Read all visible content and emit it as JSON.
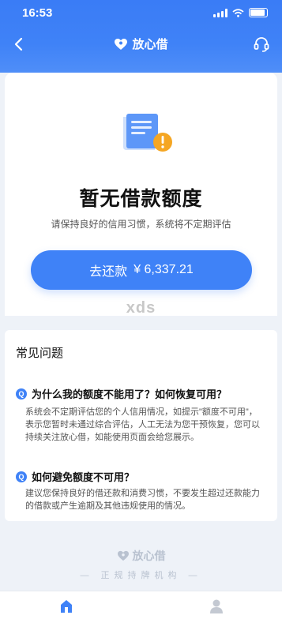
{
  "status_bar": {
    "time": "16:53"
  },
  "nav": {
    "title": "放心借"
  },
  "main": {
    "title": "暂无借款额度",
    "subtitle": "请保持良好的信用习惯，系统将不定期评估",
    "repay_label": "去还款",
    "repay_amount": "¥ 6,337.21",
    "watermark": "xds"
  },
  "faq": {
    "heading": "常见问题",
    "items": [
      {
        "badge": "Q",
        "question": "为什么我的额度不能用了？如何恢复可用？",
        "answer": "系统会不定期评估您的个人信用情况，如提示\"额度不可用\"，表示您暂时未通过综合评估，人工无法为您干预恢复，您可以持续关注放心借，如能使用页面会给您展示。"
      },
      {
        "badge": "Q",
        "question": "如何避免额度不可用？",
        "answer": "建议您保持良好的借还款和消费习惯，不要发生超过还款能力的借款或产生逾期及其他违规使用的情况。"
      }
    ]
  },
  "footer": {
    "brand": "放心借",
    "tagline": "正规持牌机构"
  },
  "colors": {
    "accent": "#3f82f7",
    "warning": "#f5a623"
  },
  "icons": {
    "back": "chevron-left-icon",
    "customer_service": "headset-icon",
    "brand": "heart-logo-icon",
    "illustration": "document-warning-icon",
    "tab_home": "home-icon",
    "tab_profile": "user-icon"
  }
}
